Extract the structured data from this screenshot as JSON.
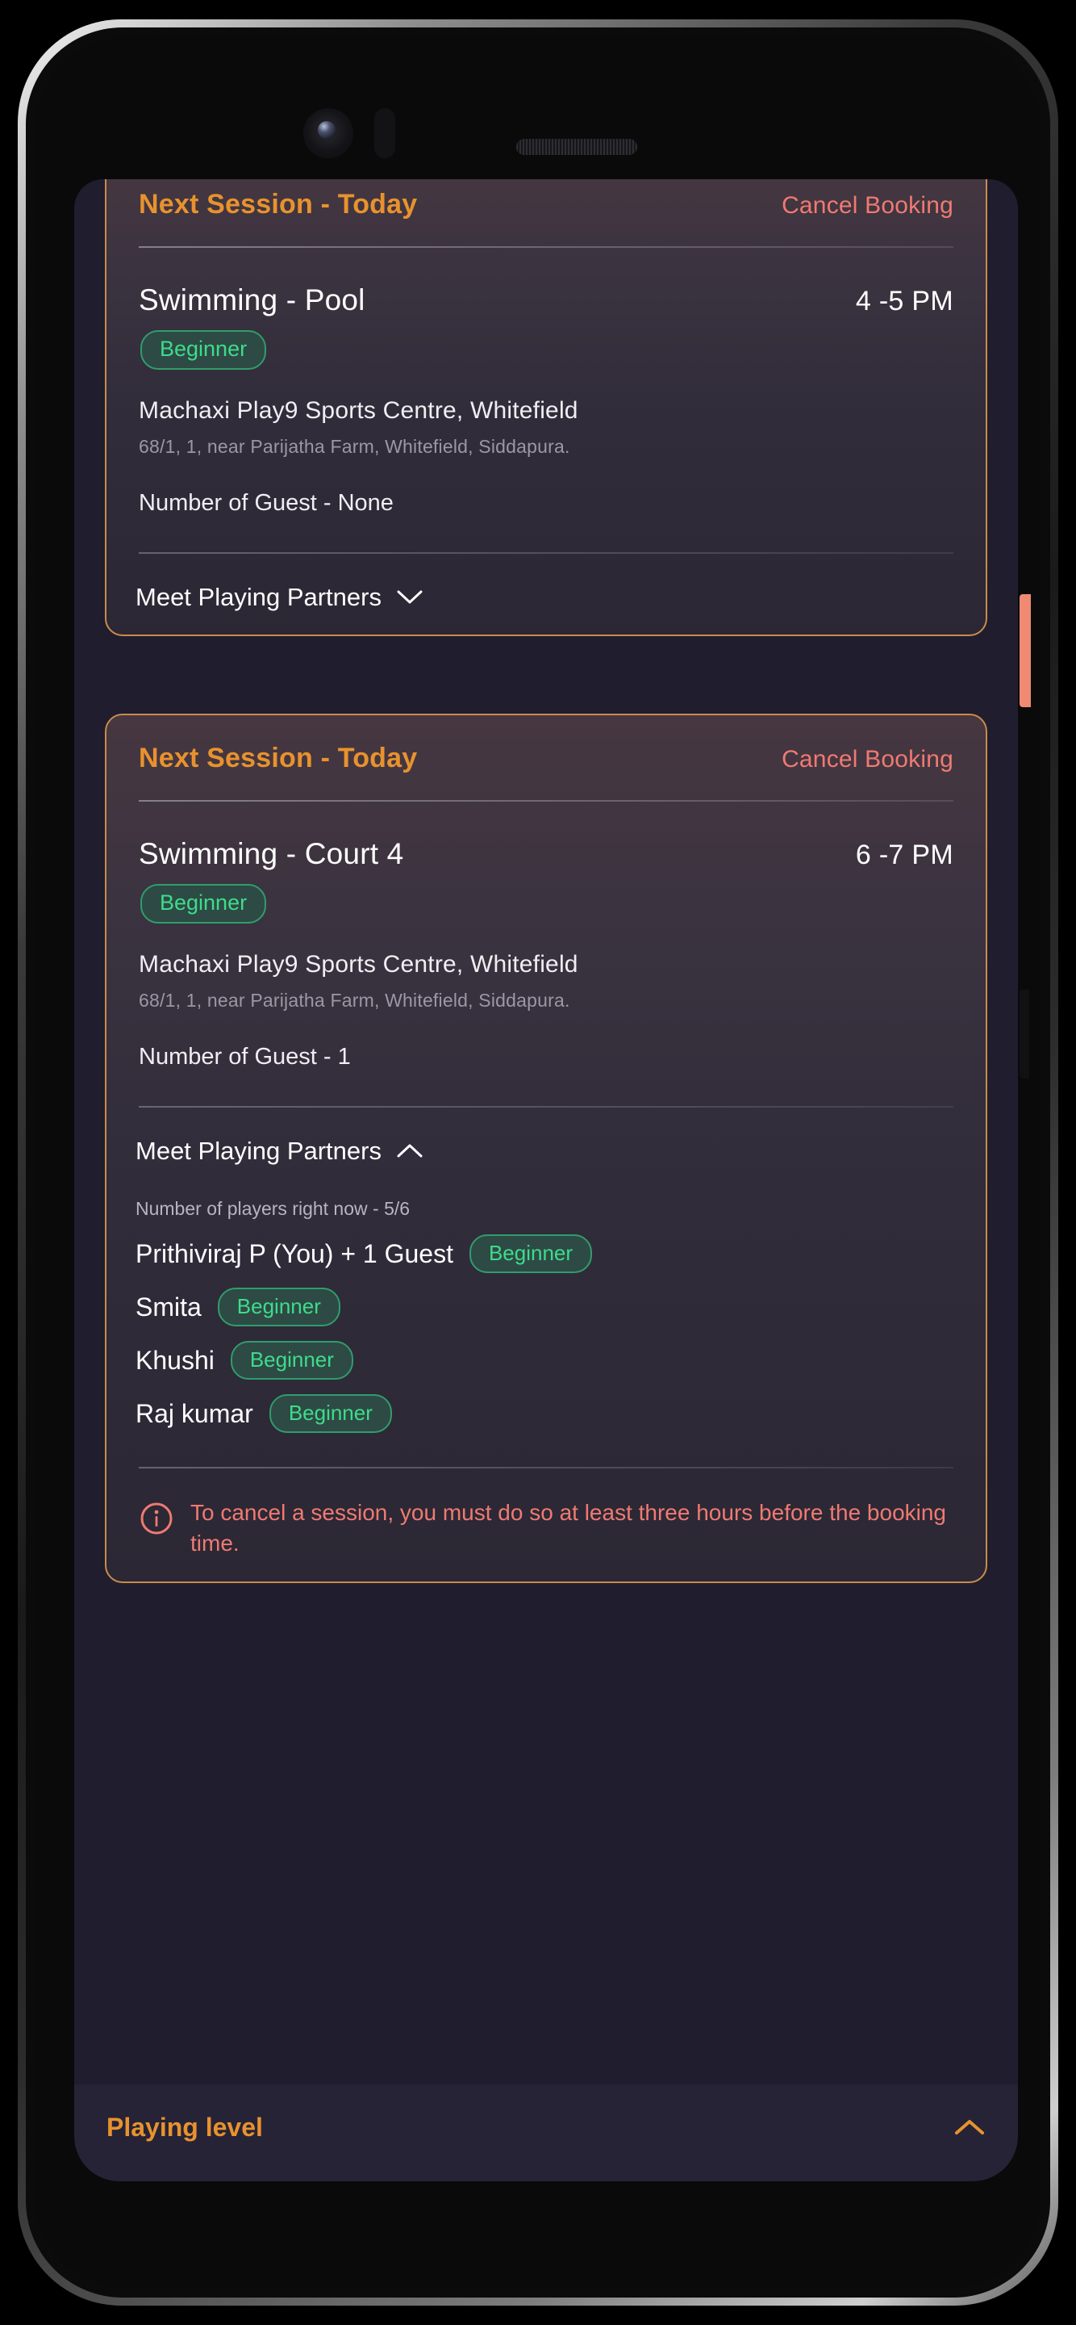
{
  "app": {
    "background_color": "#201d2e",
    "accent_orange": "#e8922e",
    "accent_coral": "#ef7a72",
    "accent_green": "#3ddc8b",
    "card_border": "#c98c4a"
  },
  "sessions": [
    {
      "header_label": "Next Session - Today",
      "cancel_label": "Cancel Booking",
      "title": "Swimming - Pool",
      "time": "4 -5 PM",
      "level_badge": "Beginner",
      "venue": "Machaxi Play9 Sports Centre, Whitefield",
      "address": "68/1, 1, near Parijatha Farm, Whitefield, Siddapura.",
      "guests": "Number of Guest - None",
      "partners_label": "Meet Playing Partners",
      "partners_expanded": false,
      "chevron_icon": "chevron-down-icon"
    },
    {
      "header_label": "Next Session - Today",
      "cancel_label": "Cancel Booking",
      "title": "Swimming - Court 4",
      "time": "6 -7 PM",
      "level_badge": "Beginner",
      "venue": "Machaxi Play9 Sports Centre, Whitefield",
      "address": "68/1, 1, near Parijatha Farm, Whitefield, Siddapura.",
      "guests": "Number of Guest - 1",
      "partners_label": "Meet Playing Partners",
      "partners_expanded": true,
      "chevron_icon": "chevron-up-icon",
      "players_count_label": "Number of players right now - 5/6",
      "players": [
        {
          "name": "Prithiviraj P (You) + 1 Guest",
          "level": "Beginner"
        },
        {
          "name": "Smita",
          "level": "Beginner"
        },
        {
          "name": "Khushi",
          "level": "Beginner"
        },
        {
          "name": "Raj kumar",
          "level": "Beginner"
        }
      ],
      "notice": {
        "icon": "info-icon",
        "text": "To cancel a session, you must do so at least three hours before the booking time."
      }
    }
  ],
  "bottom_bar": {
    "label": "Playing level",
    "chevron_icon": "chevron-up-icon"
  }
}
